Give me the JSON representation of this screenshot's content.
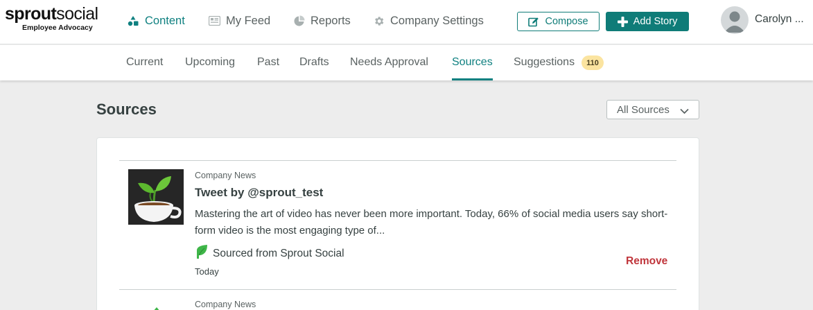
{
  "brand": {
    "name_bold": "sprout",
    "name_regular": "social",
    "tagline": "Employee Advocacy"
  },
  "nav": {
    "items": [
      {
        "label": "Content",
        "icon": "content-icon",
        "active": true
      },
      {
        "label": "My Feed",
        "icon": "feed-icon",
        "active": false
      },
      {
        "label": "Reports",
        "icon": "reports-icon",
        "active": false
      },
      {
        "label": "Company Settings",
        "icon": "gear-icon",
        "active": false
      }
    ],
    "compose_label": "Compose",
    "add_story_label": "Add Story"
  },
  "user": {
    "name": "Carolyn ..."
  },
  "tabs": [
    {
      "label": "Current",
      "active": false
    },
    {
      "label": "Upcoming",
      "active": false
    },
    {
      "label": "Past",
      "active": false
    },
    {
      "label": "Drafts",
      "active": false
    },
    {
      "label": "Needs Approval",
      "active": false
    },
    {
      "label": "Sources",
      "active": true
    },
    {
      "label": "Suggestions",
      "active": false,
      "badge": "110"
    }
  ],
  "page": {
    "title": "Sources",
    "filter_value": "All Sources"
  },
  "posts": [
    {
      "category": "Company News",
      "title": "Tweet by @sprout_test",
      "body": "Mastering the art of video has never been more important. Today, 66% of social media users say short-form video is the most engaging type of...",
      "source": "Sourced from Sprout Social",
      "date": "Today",
      "action": "Remove"
    },
    {
      "category": "Company News"
    }
  ],
  "colors": {
    "accent": "#0f8080",
    "primary_button": "#0f7c78",
    "danger": "#c0363c",
    "badge_bg": "#fbe4a0",
    "page_bg": "#ededed",
    "source_leaf": "#3fb649"
  }
}
